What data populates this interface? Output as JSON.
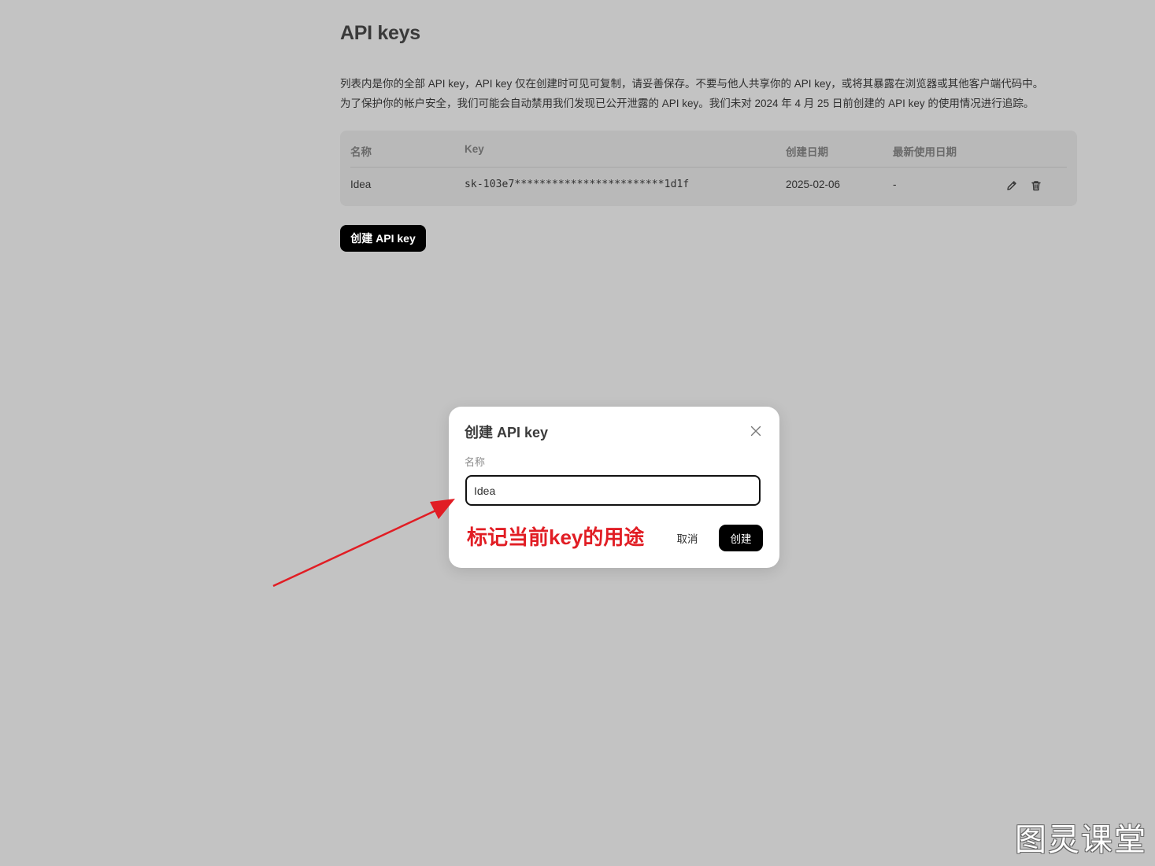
{
  "page": {
    "title": "API keys",
    "description": [
      "列表内是你的全部 API key，API key 仅在创建时可见可复制，请妥善保存。不要与他人共享你的 API key，或将其暴露在浏览器或其他客户端代码中。",
      "为了保护你的帐户安全，我们可能会自动禁用我们发现已公开泄露的 API key。我们未对 2024 年 4 月 25 日前创建的 API key 的使用情况进行追踪。"
    ]
  },
  "table": {
    "headers": [
      "名称",
      "Key",
      "创建日期",
      "最新使用日期"
    ],
    "rows": [
      {
        "name": "Idea",
        "key": "sk-103e7************************1d1f",
        "created": "2025-02-06",
        "last_used": "-"
      }
    ]
  },
  "create_button_label": "创建 API key",
  "modal": {
    "title": "创建 API key",
    "name_label": "名称",
    "name_value": "Idea",
    "cancel_label": "取消",
    "confirm_label": "创建"
  },
  "annotation": {
    "text": "标记当前key的用途",
    "color": "#e11d24"
  },
  "watermark": "图灵课堂",
  "icons": [
    "edit-icon",
    "delete-icon",
    "close-icon"
  ]
}
